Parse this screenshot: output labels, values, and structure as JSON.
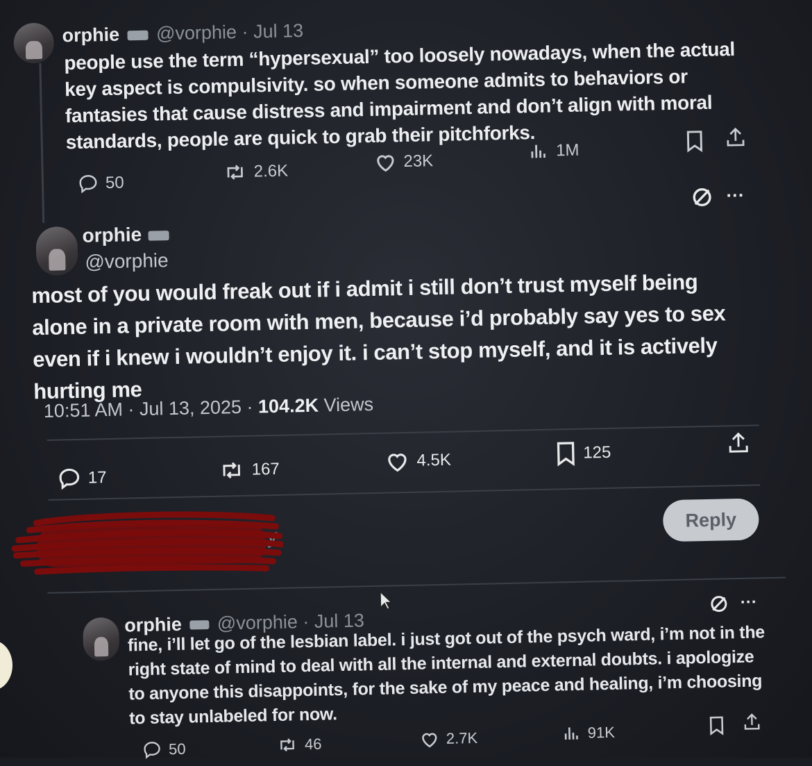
{
  "post1": {
    "display_name": "orphie",
    "handle": "@vorphie",
    "date": "· Jul 13",
    "text": "people use the term “hypersexual” too loosely nowadays, when the actual key aspect is compulsivity. so when someone admits to behaviors or fantasies that cause distress and impairment and don’t align with moral standards, people are quick to grab their pitchforks.",
    "replies": "50",
    "reposts": "2.6K",
    "likes": "23K",
    "views": "1M"
  },
  "post2": {
    "display_name": "orphie",
    "handle": "@vorphie",
    "text": "most of you would freak out if i admit i still don’t trust myself being alone in a private room with men, because i’d probably say yes to sex even if i knew i wouldn’t enjoy it. i can’t stop myself, and it is actively hurting me",
    "time": "10:51 AM · Jul 13, 2025 · ",
    "views_count": "104.2K",
    "views_label": " Views",
    "replies": "17",
    "reposts": "167",
    "likes": "4.5K",
    "bookmarks": "125"
  },
  "composer": {
    "placeholder_tail": "y",
    "reply_button": "Reply"
  },
  "post3": {
    "display_name": "orphie",
    "handle": "@vorphie",
    "date": "· Jul 13",
    "text": "fine, i’ll let go of the lesbian label. i just got out of the psych ward, i’m not in the right state of mind to deal with all the internal and external doubts. i apologize to anyone this disappoints, for the sake of my peace and healing, i’m choosing to stay unlabeled for now.",
    "replies": "50",
    "reposts": "46",
    "likes": "2.7K",
    "views": "91K"
  },
  "colors": {
    "background": "#1e2027",
    "text": "#e7e9ea",
    "muted": "#8b9199",
    "redaction": "#7a0c0c"
  }
}
